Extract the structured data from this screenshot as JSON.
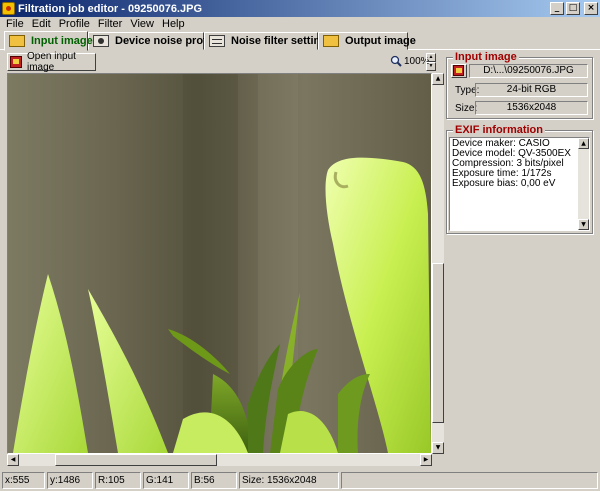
{
  "window": {
    "title": "Filtration job editor - 09250076.JPG",
    "controls": {
      "minimize": "_",
      "maximize": "□",
      "close": "×"
    }
  },
  "menu": [
    "File",
    "Edit",
    "Profile",
    "Filter",
    "View",
    "Help"
  ],
  "tabs": [
    {
      "label": "Input image",
      "icon": "folder-icon",
      "active": true
    },
    {
      "label": "Device noise profile",
      "icon": "camera-icon",
      "active": false
    },
    {
      "label": "Noise filter settings",
      "icon": "sliders-icon",
      "active": false
    },
    {
      "label": "Output image",
      "icon": "folder-icon",
      "active": false
    }
  ],
  "toolbar": {
    "open_label": "Open input image",
    "zoom_value": "100%"
  },
  "input_image": {
    "title": "Input image",
    "path": "D:\\...\\09250076.JPG",
    "type_label": "Type:",
    "type_value": "24-bit RGB",
    "size_label": "Size:",
    "size_value": "1536x2048"
  },
  "exif": {
    "title": "EXIF information",
    "lines": [
      "Device maker: CASIO",
      "Device model: QV-3500EX",
      "Compression: 3 bits/pixel",
      "Exposure time: 1/172s",
      "Exposure bias: 0,00 eV"
    ]
  },
  "status": {
    "x": "x:555",
    "y": "y:1486",
    "r": "R:105",
    "g": "G:141",
    "b": "B:56",
    "size": "Size: 1536x2048"
  },
  "colors": {
    "title_gradient_start": "#0a246a",
    "title_gradient_end": "#a6caf0",
    "group_title": "#a00000",
    "active_tab": "#006000"
  }
}
